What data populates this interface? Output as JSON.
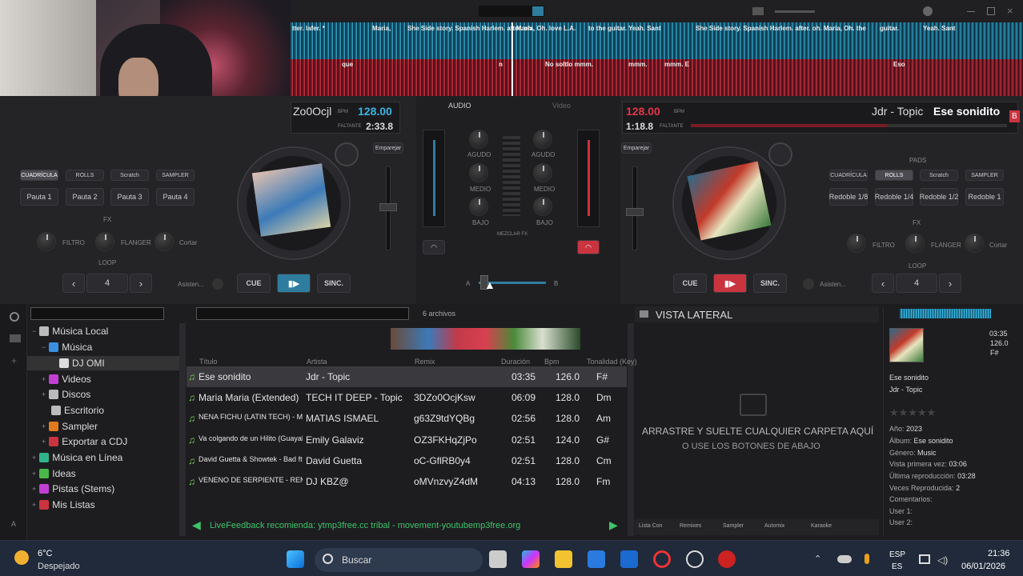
{
  "deckA": {
    "title_partial": "Zo0Ocjl",
    "bpm": "128.00",
    "bpm_label": "BPM",
    "time": "2:33.8",
    "time_label": "FALTANTE",
    "pads_tabs": [
      "CUADRÍCULA",
      "ROLLS",
      "Scratch",
      "SAMPLER"
    ],
    "pads": [
      "Pauta 1",
      "Pauta 2",
      "Pauta 3",
      "Pauta 4"
    ],
    "fx_label": "FX",
    "fx": [
      "FILTRO",
      "FLANGER",
      "Cortar"
    ],
    "loop_label": "LOOP",
    "loop_value": "4",
    "assist": "Asisten...",
    "cue": "CUE",
    "sync": "SINC.",
    "pitch_btn": "Emparejar"
  },
  "deckB": {
    "artist": "Jdr - Topic",
    "title": "Ese sonidito",
    "deck_letter": "B",
    "bpm": "128.00",
    "bpm_label": "BPM",
    "time": "1:18.8",
    "time_label": "FALTANTE",
    "pads_header": "PADS",
    "pads_tabs": [
      "CUADRÍCULA",
      "ROLLS",
      "Scratch",
      "SAMPLER"
    ],
    "pads": [
      "Redoble 1/8",
      "Redoble 1/4",
      "Redoble 1/2",
      "Redoble 1"
    ],
    "fx_label": "FX",
    "fx": [
      "FILTRO",
      "FLANGER",
      "Cortar"
    ],
    "loop_label": "LOOP",
    "loop_value": "4",
    "assist": "Asisten...",
    "cue": "CUE",
    "sync": "SINC.",
    "pitch_btn": "Emparejar"
  },
  "mixer": {
    "tab_audio": "AUDIO",
    "tab_video": "Video",
    "eq": [
      "AGUDO",
      "MEDIO",
      "BAJO"
    ],
    "mezclar": "MEZCLAR FX",
    "crossfader_a": "A",
    "crossfader_b": "B"
  },
  "waveform_labels_top": [
    "tter. lafer. *",
    "Maria,",
    "She Side story. Spanish Harlem. after. oh.",
    "Maria, Oh. love L.A.",
    "to the guitar. Yeah. Sant",
    "She Side story. Spanish Harlem. after. oh. Maria, Oh. the",
    "guitar.",
    "Yeah. Sant"
  ],
  "waveform_labels_bottom": [
    "que",
    "n",
    "No soltlo mmm.",
    "mmm.",
    "mmm. E",
    "Eso"
  ],
  "browser": {
    "search_placeholder": "",
    "file_count": "6 archivos",
    "tree": [
      {
        "label": "Música Local",
        "indent": 0,
        "color": "#bbb"
      },
      {
        "label": "Música",
        "indent": 1,
        "color": "#3a8fe0"
      },
      {
        "label": "DJ OMI",
        "indent": 2,
        "color": "#ddd"
      },
      {
        "label": "Videos",
        "indent": 1,
        "color": "#c33fd4"
      },
      {
        "label": "Discos",
        "indent": 1,
        "color": "#bbb"
      },
      {
        "label": "Escritorio",
        "indent": 1,
        "color": "#bbb"
      },
      {
        "label": "Sampler",
        "indent": 1,
        "color": "#e07a20"
      },
      {
        "label": "Exportar a CDJ",
        "indent": 1,
        "color": "#c9343f"
      },
      {
        "label": "Música en Línea",
        "indent": 0,
        "color": "#2fb38a"
      },
      {
        "label": "Ideas",
        "indent": 0,
        "color": "#49b84a"
      },
      {
        "label": "Pistas (Stems)",
        "indent": 0,
        "color": "#c33fd4"
      },
      {
        "label": "Mis Listas",
        "indent": 0,
        "color": "#c9343f"
      }
    ],
    "side_tabs": [
      "Carpetas",
      "Sideview"
    ],
    "columns": [
      "Título",
      "Artista",
      "Remix",
      "Duración",
      "Bpm",
      "Tonalidad (Key)"
    ],
    "rows": [
      {
        "title": "Ese sonidito",
        "artist": "Jdr - Topic",
        "remix": "",
        "duration": "03:35",
        "bpm": "126.0",
        "key": "F#"
      },
      {
        "title": "Maria Maria (Extended)",
        "artist": "TECH IT DEEP - Topic",
        "remix": "3DZo0OcjKsw",
        "duration": "06:09",
        "bpm": "128.0",
        "key": "Dm"
      },
      {
        "title": "NENA FICHU (LATIN TECH) - Mati...",
        "artist": "MATIAS ISMAEL",
        "remix": "g63Z9tdYQBg",
        "duration": "02:56",
        "bpm": "128.0",
        "key": "Am"
      },
      {
        "title": "Va colgando de un Hilito (Guayabo...",
        "artist": "Emily Galaviz",
        "remix": "OZ3FKHqZjPo",
        "duration": "02:51",
        "bpm": "124.0",
        "key": "G#"
      },
      {
        "title": "David Guetta & Showtek - Bad ft.V...",
        "artist": "David Guetta",
        "remix": "oC-GflRB0y4",
        "duration": "02:51",
        "bpm": "128.0",
        "key": "Cm"
      },
      {
        "title": "VENENO DE SERPIENTE - REMI...",
        "artist": "DJ KBZ@",
        "remix": "oMVnzvyZ4dM",
        "duration": "04:13",
        "bpm": "128.0",
        "key": "Fm"
      }
    ],
    "livefeedback": "LiveFeedback recomienda: ytmp3free.cc tribal - movement-youtubemp3free.org"
  },
  "sideview": {
    "title": "VISTA LATERAL",
    "drop_line1": "ARRASTRE Y SUELTE CUALQUIER CARPETA AQUÍ",
    "drop_line2": "O USE LOS BOTONES DE ABAJO",
    "bottom_tabs": [
      "Lista Con",
      "Remixes",
      "Sampler",
      "Automix",
      "Karaoke"
    ]
  },
  "info": {
    "time": "03:35",
    "bpm": "126.0",
    "key": "F#",
    "title": "Ese sonidito",
    "artist": "Jdr - Topic",
    "year_label": "Año:",
    "year": "2023",
    "album_label": "Álbum:",
    "album": "Ese sonidito",
    "genre_label": "Género:",
    "genre": "Music",
    "first_label": "Vista primera vez:",
    "first": "03:06",
    "last_label": "Última reproducción:",
    "last": "03:28",
    "plays_label": "Veces Reproducida:",
    "plays": "2",
    "comments_label": "Comentarios:",
    "user1": "User 1:",
    "user2": "User 2:"
  },
  "taskbar": {
    "temp": "6°C",
    "weather": "Despejado",
    "search": "Buscar",
    "lang1": "ESP",
    "lang2": "ES",
    "clock": "21:36",
    "date": "06/01/2026"
  }
}
